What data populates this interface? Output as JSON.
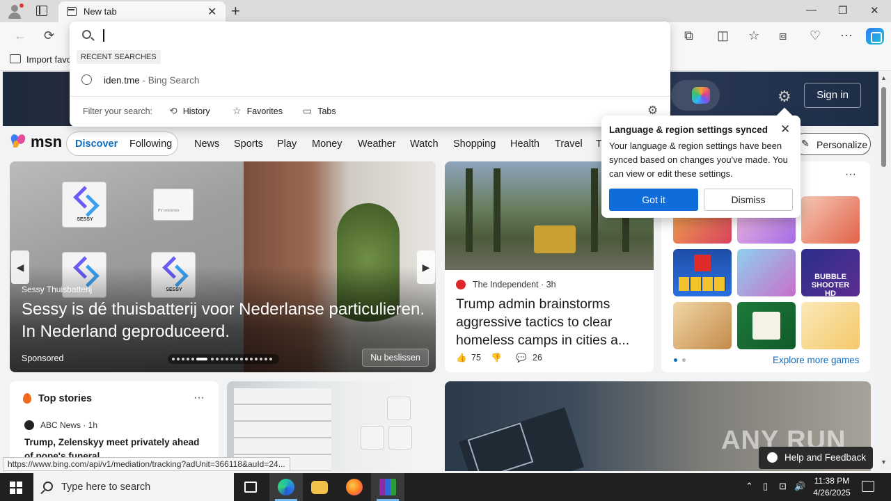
{
  "browser": {
    "tab_title": "New tab",
    "tab_close": "✕",
    "new_tab": "+",
    "window_min": "—",
    "window_max": "❐",
    "window_close": "✕",
    "favorites_import": "Import favo"
  },
  "toolbar": {
    "back": "←",
    "refresh": "⟳",
    "extensions": "⧉",
    "split": "◫",
    "favorites": "☆",
    "collections": "⧈",
    "performance": "♡",
    "more": "⋯"
  },
  "omnibox": {
    "value": "",
    "recent_label": "RECENT SEARCHES",
    "history_query": "iden.tme",
    "history_suffix": " - Bing Search",
    "filter_label": "Filter your search:",
    "filters": [
      {
        "icon": "⟲",
        "label": "History"
      },
      {
        "icon": "☆",
        "label": "Favorites"
      },
      {
        "icon": "▭",
        "label": "Tabs"
      }
    ],
    "settings_icon": "⚙"
  },
  "banner": {
    "signin_label": "Sign in",
    "gear": "⚙"
  },
  "msn": {
    "logo_text": "msn",
    "discover": "Discover",
    "following": "Following",
    "nav": [
      "News",
      "Sports",
      "Play",
      "Money",
      "Weather",
      "Watch",
      "Shopping",
      "Health",
      "Travel",
      "T"
    ],
    "personalize": "Personalize",
    "personalize_icon": "✎"
  },
  "hero": {
    "source": "Sessy Thuisbatterij",
    "title": "Sessy is dé thuisbatterij voor Nederlanse particulieren. In Nederland geproduceerd.",
    "sponsored": "Sponsored",
    "cta": "Nu beslissen",
    "battery_label": "SESSY",
    "inverter_label": "PV omvormer",
    "prev": "◀",
    "next": "▶"
  },
  "news": {
    "publisher": "The Independent · 3h",
    "headline": "Trump admin brainstorms aggressive tactics to clear homeless camps in cities a...",
    "likes": "75",
    "comments": "26",
    "like_icon": "👍",
    "dislike_icon": "👎",
    "comment_icon": "💬"
  },
  "games": {
    "more": "···",
    "explore": "Explore more games",
    "bubble_label": "BUBBLE SHOOTER HD"
  },
  "top_stories": {
    "title": "Top stories",
    "more": "···",
    "source": "ABC News · 1h",
    "headline": "Trump, Zelenskyy meet privately ahead of pope's funeral"
  },
  "popup": {
    "title": "Language & region settings synced",
    "body": "Your language & region settings have been synced based on changes you've made. You can view or edit these settings.",
    "got_it": "Got it",
    "dismiss": "Dismiss",
    "close": "✕"
  },
  "watermark": "ANY RUN",
  "help": {
    "label": "Help and Feedback"
  },
  "status_url": "https://www.bing.com/api/v1/mediation/tracking?adUnit=366118&auId=24...",
  "taskbar": {
    "search_placeholder": "Type here to search",
    "time": "11:38 PM",
    "date": "4/26/2025",
    "tray_chevron": "⌃",
    "volume": "🔊"
  }
}
